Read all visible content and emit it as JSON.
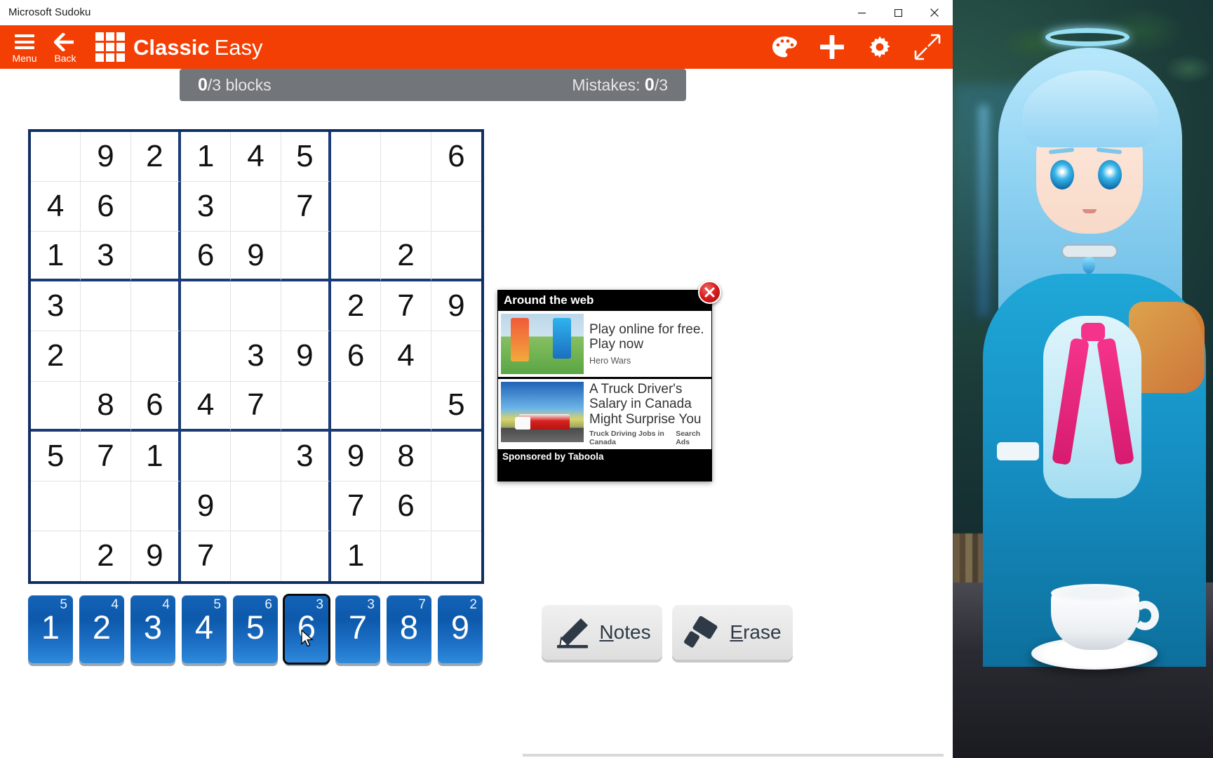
{
  "window": {
    "title": "Microsoft Sudoku",
    "controls": {
      "minimize": "minimize-button",
      "maximize": "maximize-button",
      "close": "close-button"
    }
  },
  "toolbar": {
    "menu_label": "Menu",
    "back_label": "Back",
    "title_bold": "Classic",
    "title_light": "Easy",
    "icons": {
      "logo": "grid-logo-icon",
      "hamburger": "hamburger-icon",
      "back": "back-arrow-icon",
      "theme": "palette-icon",
      "add": "plus-icon",
      "settings": "gear-icon",
      "fullscreen": "expand-arrows-icon"
    }
  },
  "status": {
    "blocks_value": "0",
    "blocks_total": "/3 blocks",
    "mistakes_label": "Mistakes: ",
    "mistakes_value": "0",
    "mistakes_total": "/3"
  },
  "board": {
    "rows": [
      [
        "",
        "9",
        "2",
        "1",
        "4",
        "5",
        "",
        "",
        "6"
      ],
      [
        "4",
        "6",
        "",
        "3",
        "",
        "7",
        "",
        "",
        ""
      ],
      [
        "1",
        "3",
        "",
        "6",
        "9",
        "",
        "",
        "2",
        ""
      ],
      [
        "3",
        "",
        "",
        "",
        "",
        "",
        "2",
        "7",
        "9"
      ],
      [
        "2",
        "",
        "",
        "",
        "3",
        "9",
        "6",
        "4",
        ""
      ],
      [
        "",
        "8",
        "6",
        "4",
        "7",
        "",
        "",
        "",
        "5"
      ],
      [
        "5",
        "7",
        "1",
        "",
        "",
        "3",
        "9",
        "8",
        ""
      ],
      [
        "",
        "",
        "",
        "9",
        "",
        "",
        "7",
        "6",
        ""
      ],
      [
        "",
        "2",
        "9",
        "7",
        "",
        "",
        "1",
        "",
        ""
      ]
    ]
  },
  "numpad": {
    "keys": [
      {
        "digit": "1",
        "remaining": "5",
        "selected": false
      },
      {
        "digit": "2",
        "remaining": "4",
        "selected": false
      },
      {
        "digit": "3",
        "remaining": "4",
        "selected": false
      },
      {
        "digit": "4",
        "remaining": "5",
        "selected": false
      },
      {
        "digit": "5",
        "remaining": "6",
        "selected": false
      },
      {
        "digit": "6",
        "remaining": "3",
        "selected": true
      },
      {
        "digit": "7",
        "remaining": "3",
        "selected": false
      },
      {
        "digit": "8",
        "remaining": "7",
        "selected": false
      },
      {
        "digit": "9",
        "remaining": "2",
        "selected": false
      }
    ]
  },
  "actions": {
    "notes": {
      "accel": "N",
      "rest": "otes",
      "icon": "pencil-icon"
    },
    "erase": {
      "accel": "E",
      "rest": "rase",
      "icon": "eraser-icon"
    }
  },
  "ad": {
    "header": "Around the web",
    "footer": "Sponsored by Taboola",
    "close_icon": "close-x-icon",
    "items": [
      {
        "title": "Play online for free. Play now",
        "source": "Hero Wars",
        "source_extra": ""
      },
      {
        "title": "A Truck Driver's Salary in Canada Might Surprise You",
        "source": "Truck Driving Jobs in Canada",
        "source_extra": "Search Ads"
      }
    ]
  },
  "colors": {
    "toolbar_orange": "#f33f04",
    "statusbar_gray": "#72757a",
    "grid_border_blue": "#1a3c76",
    "numkey_blue": "#0d59ab",
    "ad_close_red": "#d81c1c"
  }
}
